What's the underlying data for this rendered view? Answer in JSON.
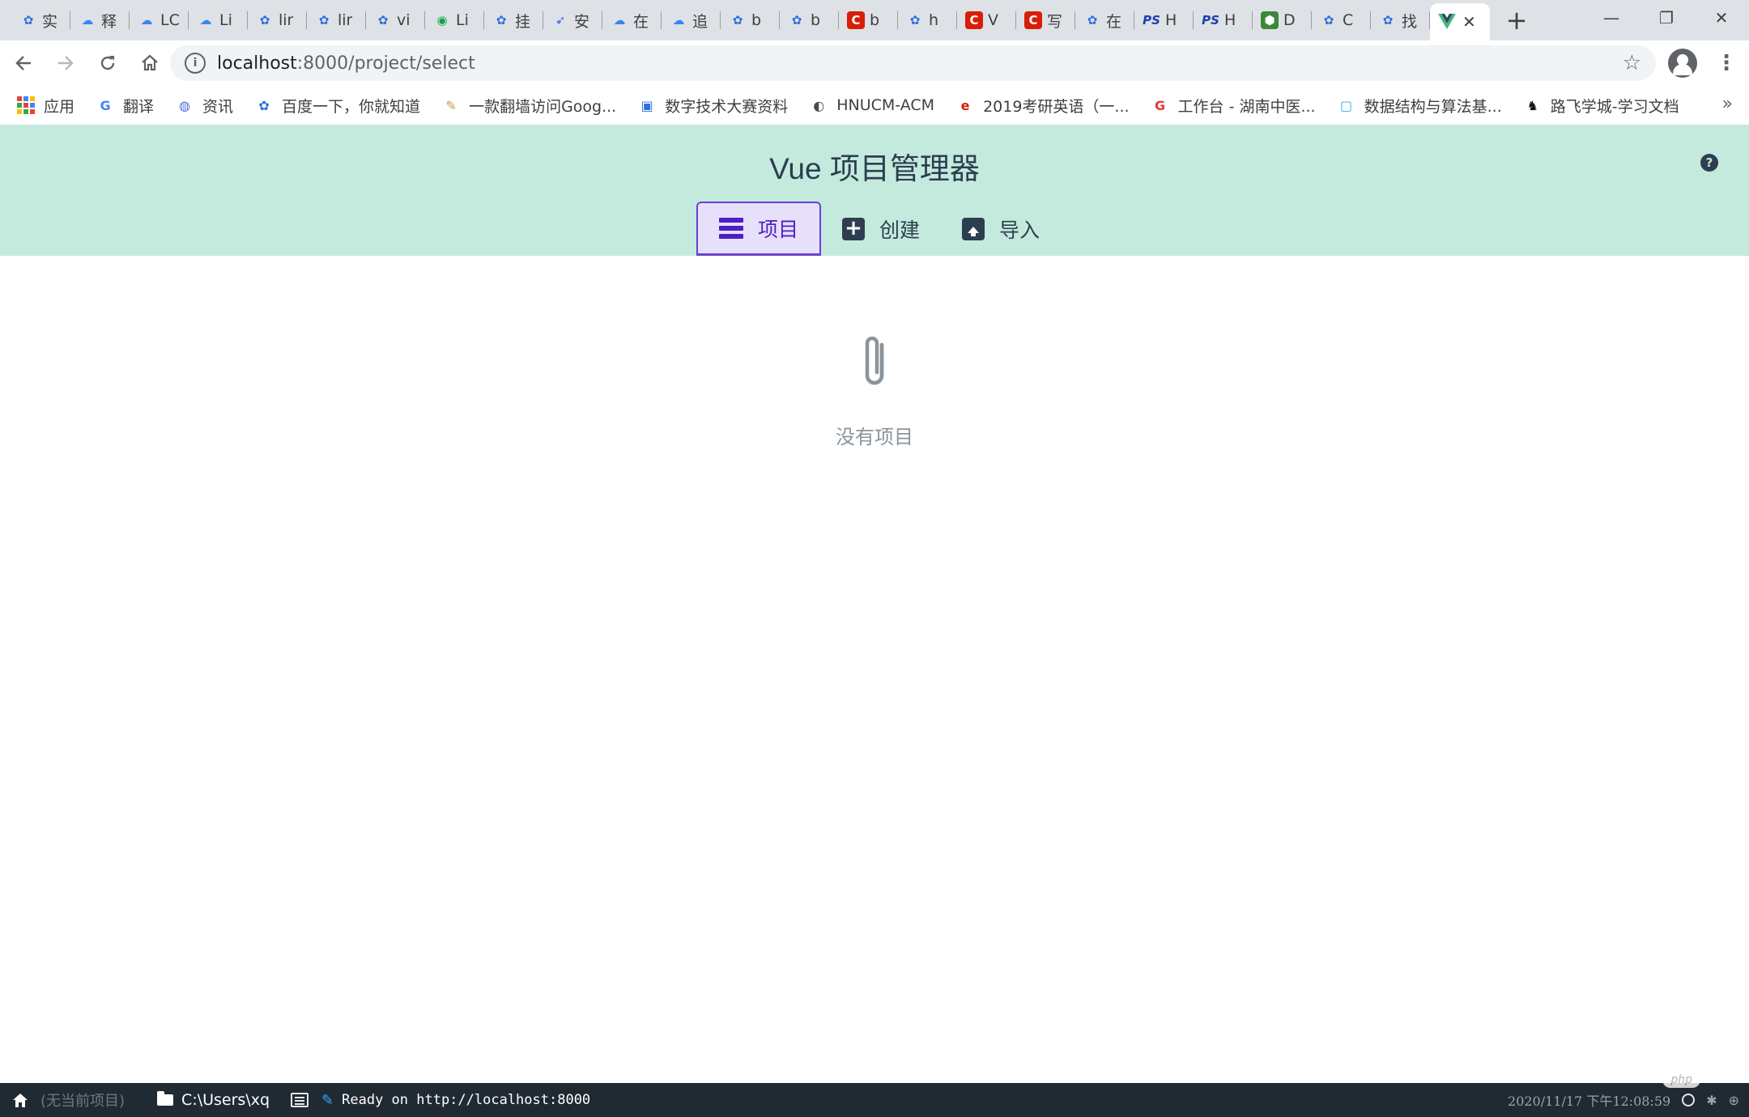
{
  "browser": {
    "tabs": [
      {
        "icon": "paw",
        "title": "实"
      },
      {
        "icon": "cloud",
        "title": "释"
      },
      {
        "icon": "cloud",
        "title": "LC"
      },
      {
        "icon": "cloud",
        "title": "Li"
      },
      {
        "icon": "paw",
        "title": "lir"
      },
      {
        "icon": "paw",
        "title": "lir"
      },
      {
        "icon": "paw",
        "title": "vi"
      },
      {
        "icon": "bot",
        "title": "Li"
      },
      {
        "icon": "paw",
        "title": "挂"
      },
      {
        "icon": "rocket",
        "title": "安"
      },
      {
        "icon": "cloud",
        "title": "在"
      },
      {
        "icon": "cloud",
        "title": "追"
      },
      {
        "icon": "paw",
        "title": "b"
      },
      {
        "icon": "paw",
        "title": "b"
      },
      {
        "icon": "csdn",
        "title": "b"
      },
      {
        "icon": "paw",
        "title": "h"
      },
      {
        "icon": "csdn",
        "title": "V"
      },
      {
        "icon": "csdn",
        "title": "写"
      },
      {
        "icon": "paw",
        "title": "在"
      },
      {
        "icon": "ps",
        "title": "H"
      },
      {
        "icon": "ps",
        "title": "H"
      },
      {
        "icon": "node",
        "title": "D"
      },
      {
        "icon": "paw",
        "title": "C"
      },
      {
        "icon": "paw",
        "title": "找"
      }
    ],
    "active_tab_icon": "vue-icon",
    "address": {
      "host": "localhost",
      "path": ":8000/project/select"
    },
    "bookmarks": [
      {
        "icon": "apps",
        "label": "应用"
      },
      {
        "icon": "translate",
        "label": "翻译"
      },
      {
        "icon": "news",
        "label": "资讯"
      },
      {
        "icon": "paw",
        "label": "百度一下，你就知道"
      },
      {
        "icon": "pin",
        "label": "一款翻墙访问Goog..."
      },
      {
        "icon": "digital",
        "label": "数字技术大赛资料"
      },
      {
        "icon": "globe",
        "label": "HNUCM-ACM"
      },
      {
        "icon": "kaoyan",
        "label": "2019考研英语（一..."
      },
      {
        "icon": "gongzuo",
        "label": "工作台 - 湖南中医..."
      },
      {
        "icon": "bilibili",
        "label": "数据结构与算法基..."
      },
      {
        "icon": "lufei",
        "label": "路飞学城-学习文档"
      }
    ]
  },
  "app": {
    "title": "Vue 项目管理器",
    "nav": [
      {
        "label": "项目",
        "icon": "list-icon",
        "selected": true
      },
      {
        "label": "创建",
        "icon": "plus-icon",
        "selected": false
      },
      {
        "label": "导入",
        "icon": "import-icon",
        "selected": false
      }
    ],
    "empty_state": {
      "icon": "paperclip-icon",
      "text": "没有项目"
    }
  },
  "statusbar": {
    "no_project": "(无当前项目)",
    "cwd": "C:\\Users\\xq",
    "message": "Ready on http://localhost:8000",
    "datetime": "2020/11/17  下午12:08:59",
    "watermark": "php"
  },
  "colors": {
    "header_bg": "#c4eadd",
    "accent": "#4f1ec5",
    "statusbar_bg": "#202a33"
  }
}
